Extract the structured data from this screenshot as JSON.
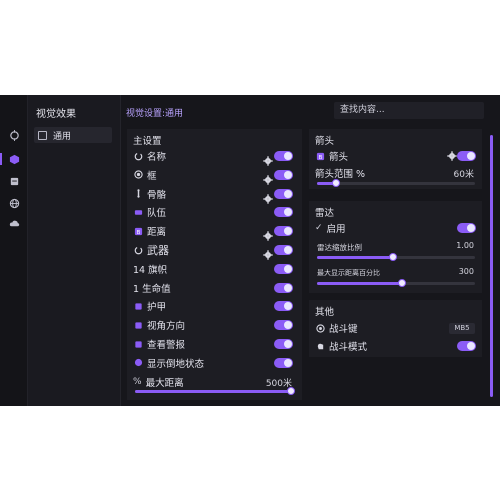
{
  "sidebar": {
    "title": "视觉效果",
    "items": [
      {
        "label": "通用"
      }
    ]
  },
  "rail": {
    "icons": [
      "crosshair-icon",
      "cube-icon",
      "box-icon",
      "globe-icon",
      "cloud-icon"
    ]
  },
  "header": {
    "breadcrumb": "视觉设置:通用",
    "search_placeholder": "查找内容..."
  },
  "main": {
    "title": "主设置",
    "rows": [
      {
        "label": "名称",
        "icon": "loader-icon",
        "gear": true,
        "on": true
      },
      {
        "label": "框",
        "icon": "target-icon",
        "gear": true,
        "on": true
      },
      {
        "label": "骨骼",
        "icon": "bone-icon",
        "gear": true,
        "on": true
      },
      {
        "label": "队伍",
        "icon": "card-icon",
        "gear": false,
        "on": true
      },
      {
        "label": "距离",
        "icon": "distance-icon",
        "gear": true,
        "on": true
      },
      {
        "label": "武器",
        "icon": "loader-icon",
        "gear": true,
        "on": true
      },
      {
        "label": "14 旗帜",
        "icon": "",
        "gear": false,
        "on": true
      },
      {
        "label": "1 生命值",
        "icon": "",
        "gear": false,
        "on": true
      },
      {
        "label": "护甲",
        "icon": "shield-icon",
        "gear": false,
        "on": true
      },
      {
        "label": "视角方向",
        "icon": "view-icon",
        "gear": false,
        "on": true
      },
      {
        "label": "查看警报",
        "icon": "alert-icon",
        "gear": false,
        "on": true
      },
      {
        "label": "显示倒地状态",
        "icon": "down-icon",
        "gear": false,
        "on": true
      }
    ],
    "max_distance": {
      "label": "最大距离",
      "value_text": "500米",
      "fraction": 1.0
    }
  },
  "arrows": {
    "title": "箭头",
    "row": {
      "label": "箭头",
      "icon": "distance-icon",
      "gear": true,
      "on": true
    },
    "range": {
      "label": "箭头范围 %",
      "value_text": "60米",
      "fraction": 0.12
    }
  },
  "radar": {
    "title": "雷达",
    "enable": {
      "label": "启用",
      "on": true
    },
    "scale": {
      "label": "雷达缩放比例",
      "value_text": "1.00",
      "fraction": 0.48
    },
    "max_percent": {
      "label": "最大显示距离百分比",
      "value_text": "300",
      "fraction": 0.54
    }
  },
  "other": {
    "title": "其他",
    "fight_key": {
      "label": "战斗键",
      "key": "MB5"
    },
    "fight_mode": {
      "label": "战斗模式",
      "on": true
    }
  },
  "colors": {
    "accent": "#8b5cf6",
    "panel": "#1d1d23",
    "bg": "#16161b"
  }
}
